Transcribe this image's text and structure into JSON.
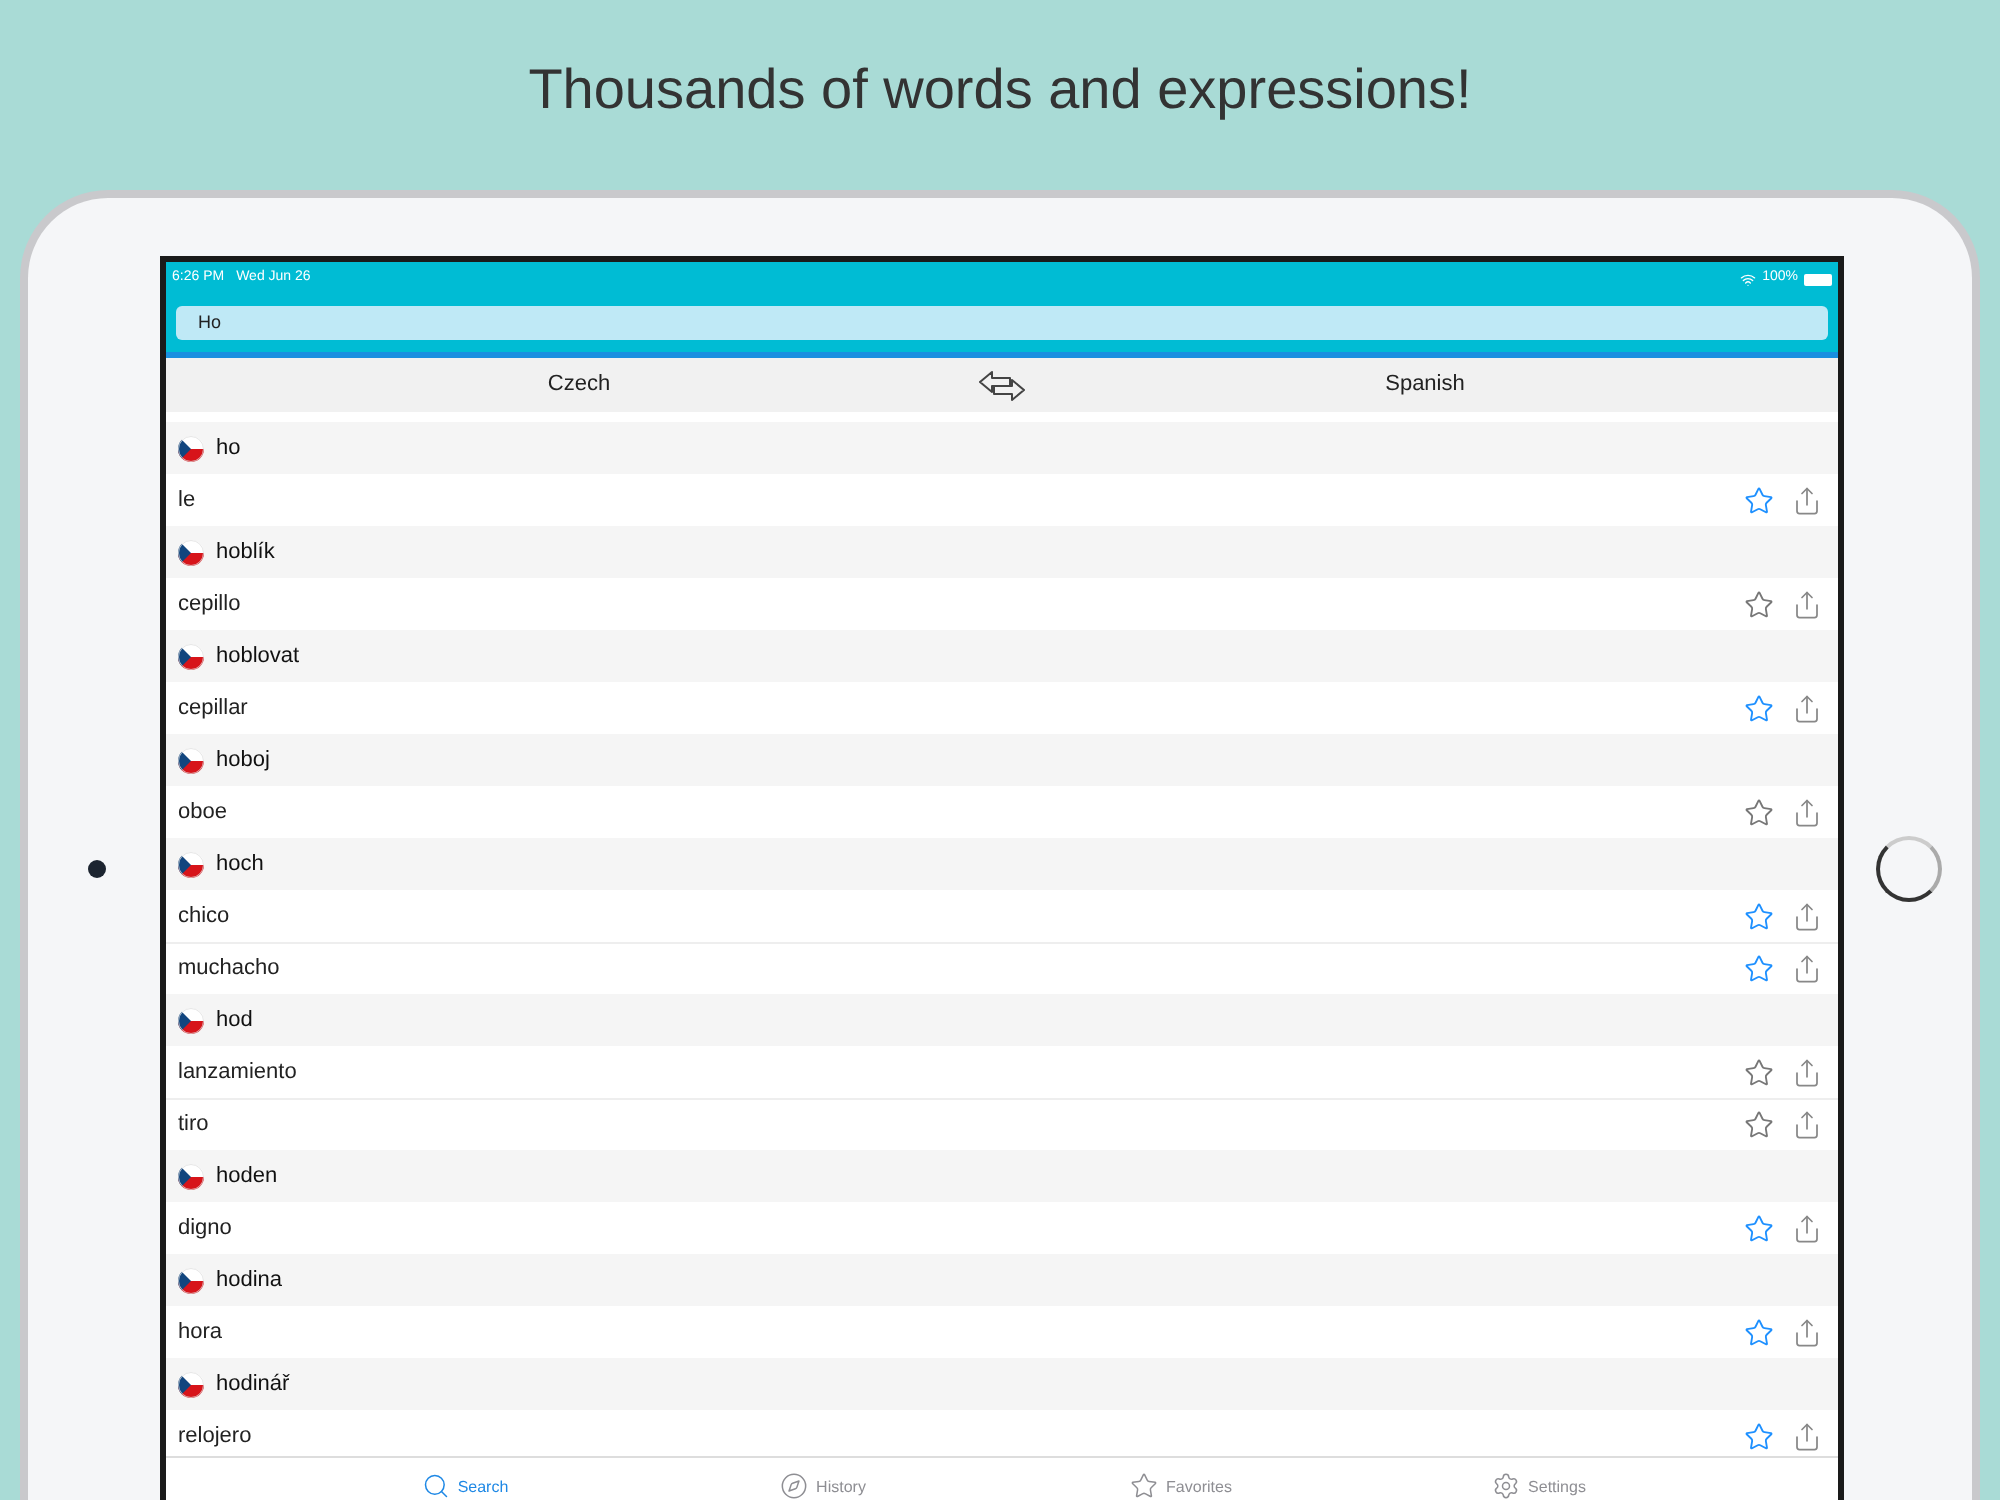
{
  "headline": "Thousands of words and expressions!",
  "status_bar": {
    "time": "6:26 PM",
    "date": "Wed Jun 26",
    "battery": "100%"
  },
  "search": {
    "value": "Ho"
  },
  "languages": {
    "source": "Czech",
    "target": "Spanish"
  },
  "entries": [
    {
      "word": "ho",
      "translations": [
        {
          "text": "le",
          "highlighted": true
        }
      ]
    },
    {
      "word": "hoblík",
      "translations": [
        {
          "text": "cepillo",
          "highlighted": false
        }
      ]
    },
    {
      "word": "hoblovat",
      "translations": [
        {
          "text": "cepillar",
          "highlighted": true
        }
      ]
    },
    {
      "word": "hoboj",
      "translations": [
        {
          "text": "oboe",
          "highlighted": false
        }
      ]
    },
    {
      "word": "hoch",
      "translations": [
        {
          "text": "chico",
          "highlighted": true
        },
        {
          "text": "muchacho",
          "highlighted": true
        }
      ]
    },
    {
      "word": "hod",
      "translations": [
        {
          "text": "lanzamiento",
          "highlighted": false
        },
        {
          "text": "tiro",
          "highlighted": false
        }
      ]
    },
    {
      "word": "hoden",
      "translations": [
        {
          "text": "digno",
          "highlighted": true
        }
      ]
    },
    {
      "word": "hodina",
      "translations": [
        {
          "text": "hora",
          "highlighted": true
        }
      ]
    },
    {
      "word": "hodinář",
      "translations": [
        {
          "text": "relojero",
          "highlighted": true
        }
      ]
    }
  ],
  "tabs": [
    {
      "kind": "search",
      "label": "Search",
      "selected": true
    },
    {
      "kind": "history",
      "label": "History",
      "selected": false
    },
    {
      "kind": "favorites",
      "label": "Favorites",
      "selected": false
    },
    {
      "kind": "settings",
      "label": "Settings",
      "selected": false
    }
  ]
}
